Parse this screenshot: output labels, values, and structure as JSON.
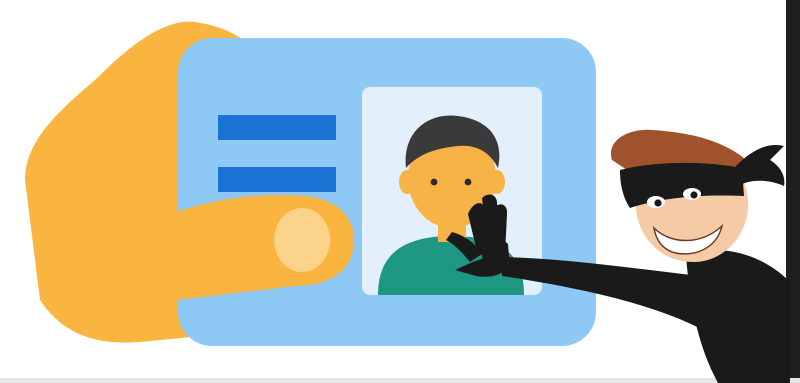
{
  "colors": {
    "background": "#ffffff",
    "hand": "#f9b540",
    "thumbnail": "#fbd38a",
    "card": "#8ec8f5",
    "card_lines": "#1a73d4",
    "photo_bg": "#e3f0fc",
    "person_skin": "#f7b346",
    "person_hair": "#3a3a3a",
    "person_shirt": "#1e9784",
    "thief_black": "#1a1a1a",
    "thief_hair": "#a0522d",
    "thief_skin": "#f5cba7",
    "right_border": "#1e1e1e"
  },
  "icons": [
    "holding-hand-icon",
    "id-card-icon",
    "id-photo-person-icon",
    "thief-icon",
    "thief-gloved-hand-icon"
  ]
}
